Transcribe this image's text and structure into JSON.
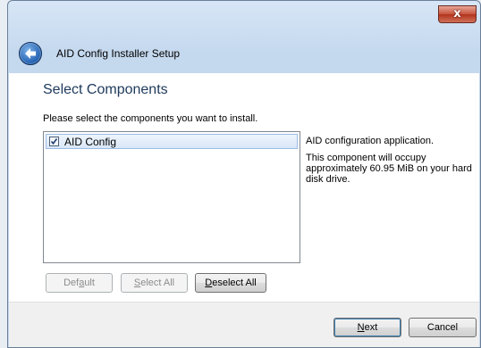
{
  "window": {
    "title": "AID Config Installer Setup",
    "close_glyph": "x"
  },
  "page": {
    "heading": "Select Components",
    "instruction": "Please select the components you want to install."
  },
  "components": [
    {
      "label": "AID Config",
      "checked": true,
      "selected": true
    }
  ],
  "description": {
    "line1": "AID configuration application.",
    "line2": "This component will occupy approximately 60.95 MiB on your hard disk drive."
  },
  "buttons": {
    "default": {
      "before": "Def",
      "accel": "a",
      "after": "ult"
    },
    "select_all": {
      "before": "",
      "accel": "S",
      "after": "elect All"
    },
    "deselect_all": {
      "before": "",
      "accel": "D",
      "after": "eselect All"
    },
    "next": {
      "before": "",
      "accel": "N",
      "after": "ext"
    },
    "cancel": "Cancel"
  },
  "colors": {
    "heading": "#1e395b",
    "accent": "#3c7fb1",
    "close": "#c7523b"
  }
}
